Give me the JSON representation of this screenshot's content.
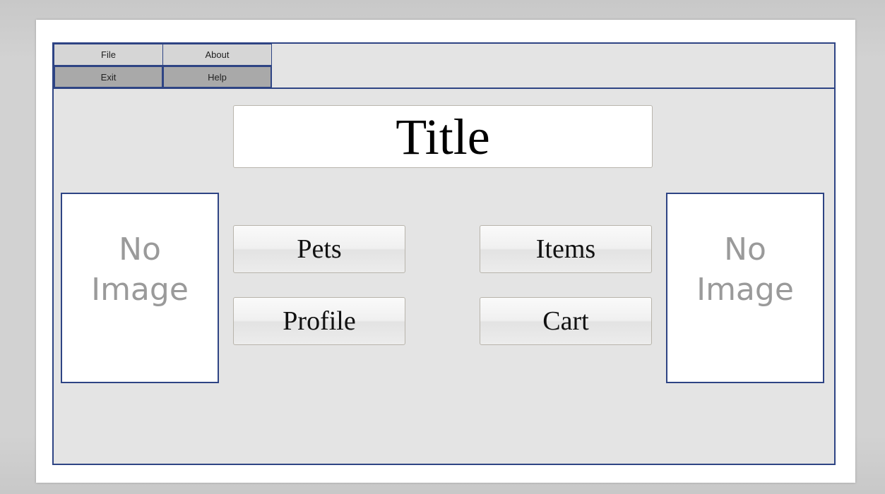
{
  "menu": {
    "file_label": "File",
    "about_label": "About",
    "exit_label": "Exit",
    "help_label": "Help"
  },
  "title": "Title",
  "placeholders": {
    "left_text": "No\nImage",
    "right_text": "No\nImage"
  },
  "buttons": {
    "pets_label": "Pets",
    "items_label": "Items",
    "profile_label": "Profile",
    "cart_label": "Cart"
  },
  "colors": {
    "frame_border": "#2e4484",
    "window_background": "#e4e4e4",
    "menu_top_background": "#d6d6d6",
    "menu_bottom_background": "#a9a9a9",
    "placeholder_text": "#9a9a9a"
  }
}
